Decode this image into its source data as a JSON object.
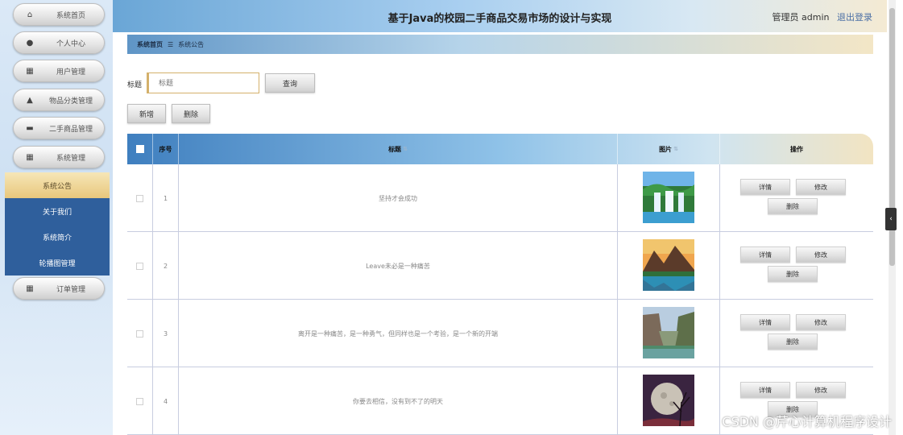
{
  "header": {
    "title": "基于Java的校园二手商品交易市场的设计与实现",
    "user": "管理员 admin",
    "logout": "退出登录"
  },
  "sidebar": {
    "items": [
      {
        "label": "系统首页",
        "icon": "home-icon",
        "glyph": "⌂"
      },
      {
        "label": "个人中心",
        "icon": "user-icon",
        "glyph": "●"
      },
      {
        "label": "用户管理",
        "icon": "grid-icon",
        "glyph": "▦"
      },
      {
        "label": "物品分类管理",
        "icon": "person-icon",
        "glyph": "▲"
      },
      {
        "label": "二手商品管理",
        "icon": "bag-icon",
        "glyph": "▬"
      },
      {
        "label": "系统管理",
        "icon": "apps-icon",
        "glyph": "▦"
      }
    ],
    "sub_items": [
      {
        "label": "系统公告",
        "active": true
      },
      {
        "label": "关于我们",
        "active": false
      },
      {
        "label": "系统简介",
        "active": false
      },
      {
        "label": "轮播图管理",
        "active": false
      }
    ],
    "after_items": [
      {
        "label": "订单管理",
        "icon": "apps-icon",
        "glyph": "▦"
      }
    ]
  },
  "breadcrumb": {
    "home": "系统首页",
    "separator": "☰",
    "current": "系统公告"
  },
  "search": {
    "label": "标题",
    "placeholder": "标题",
    "button": "查询"
  },
  "actions": {
    "add": "新增",
    "delete": "删除"
  },
  "table": {
    "columns": [
      "序号",
      "标题",
      "图片",
      "操作"
    ],
    "rows": [
      {
        "index": "1",
        "title": "坚持才会成功",
        "image": "waterfall"
      },
      {
        "index": "2",
        "title": "Leave未必是一种痛苦",
        "image": "mountain-lake"
      },
      {
        "index": "3",
        "title": "离开是一种痛苦，是一种勇气，但同样也是一个考验，是一个新的开端",
        "image": "cliff-river"
      },
      {
        "index": "4",
        "title": "你要去相信，没有到不了的明天",
        "image": "moon-tree"
      }
    ],
    "row_buttons": {
      "detail": "详情",
      "edit": "修改",
      "delete": "删除"
    }
  },
  "watermark": "CSDN @芹心计算机程序设计"
}
